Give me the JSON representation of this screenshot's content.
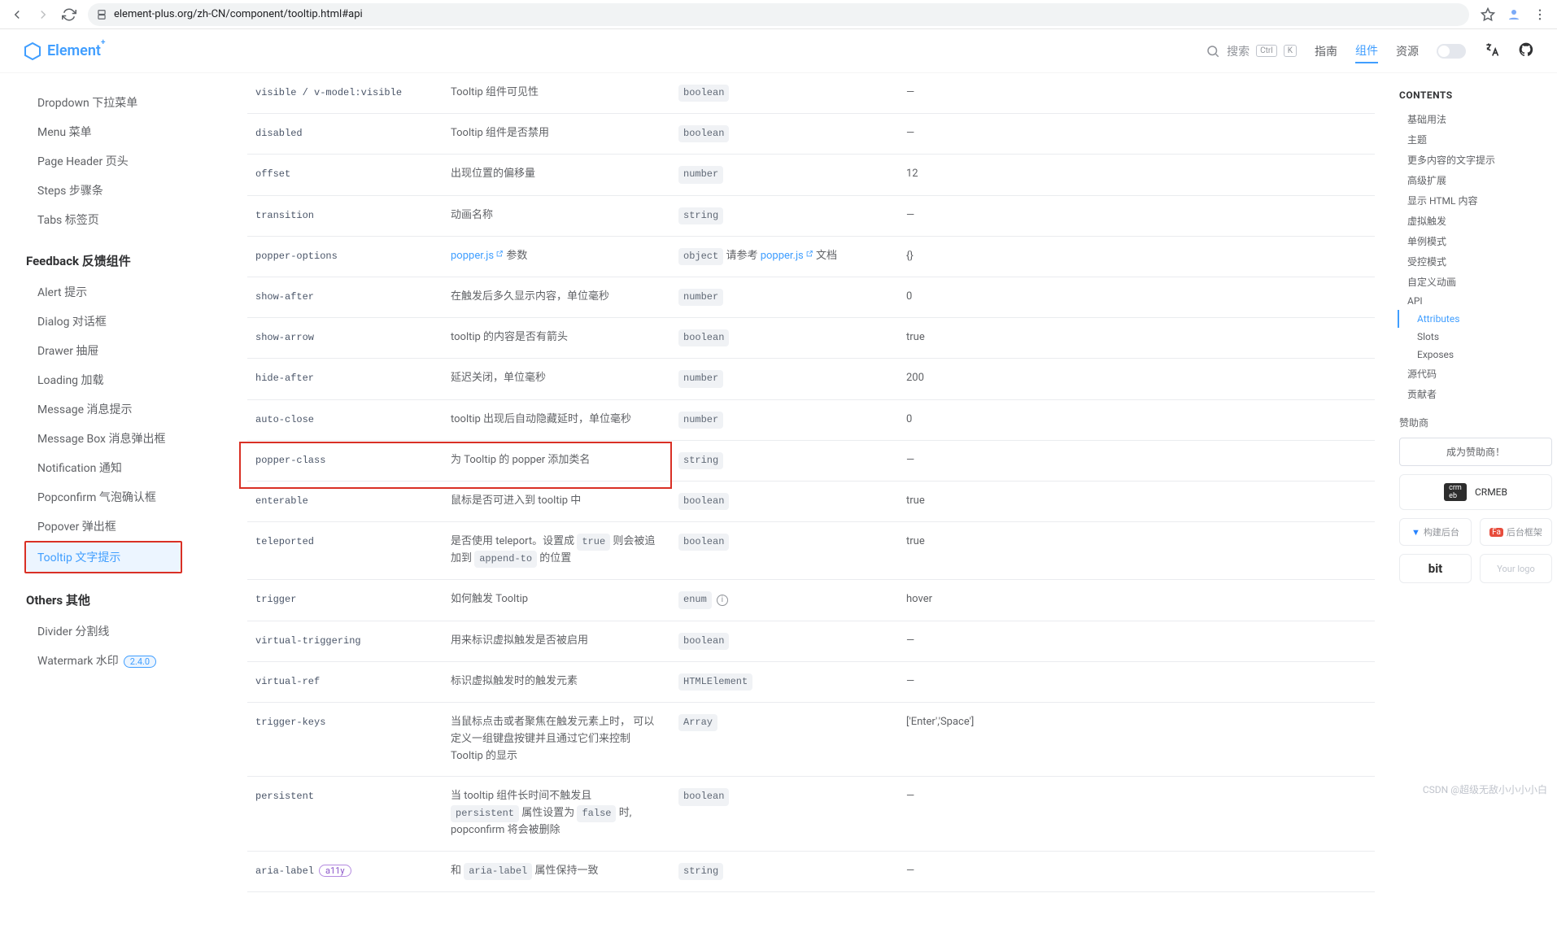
{
  "chrome": {
    "url": "element-plus.org/zh-CN/component/tooltip.html#api"
  },
  "header": {
    "brand": "Element",
    "searchPlaceholder": "搜索",
    "kbd1": "Ctrl",
    "kbd2": "K",
    "nav": {
      "guide": "指南",
      "component": "组件",
      "resource": "资源"
    }
  },
  "sidebar": {
    "items_a": [
      "Dropdown 下拉菜单",
      "Menu 菜单",
      "Page Header 页头",
      "Steps 步骤条",
      "Tabs 标签页"
    ],
    "group_feedback": "Feedback 反馈组件",
    "items_b": [
      "Alert 提示",
      "Dialog 对话框",
      "Drawer 抽屉",
      "Loading 加载",
      "Message 消息提示",
      "Message Box 消息弹出框",
      "Notification 通知",
      "Popconfirm 气泡确认框",
      "Popover 弹出框"
    ],
    "active": "Tooltip 文字提示",
    "group_others": "Others 其他",
    "items_c": [
      "Divider 分割线"
    ],
    "watermark_label": "Watermark 水印",
    "watermark_ver": "2.4.0"
  },
  "api": {
    "rows": [
      {
        "name": "visible / v-model:visible",
        "desc": "Tooltip 组件可见性",
        "type": "boolean",
        "default": "—"
      },
      {
        "name": "disabled",
        "desc": "Tooltip 组件是否禁用",
        "type": "boolean",
        "default": "—"
      },
      {
        "name": "offset",
        "desc": "出现位置的偏移量",
        "type": "number",
        "default": "12"
      },
      {
        "name": "transition",
        "desc": "动画名称",
        "type": "string",
        "default": "—"
      },
      {
        "name": "popper-options",
        "desc_pre": "",
        "link": "popper.js",
        "desc_post": " 参数",
        "type": "object",
        "type_extra_pre": "请参考 ",
        "type_link": "popper.js",
        "type_extra_post": " 文档",
        "default": "{}"
      },
      {
        "name": "show-after",
        "desc": "在触发后多久显示内容，单位毫秒",
        "type": "number",
        "default": "0"
      },
      {
        "name": "show-arrow",
        "desc": "tooltip 的内容是否有箭头",
        "type": "boolean",
        "default": "true"
      },
      {
        "name": "hide-after",
        "desc": "延迟关闭，单位毫秒",
        "type": "number",
        "default": "200"
      },
      {
        "name": "auto-close",
        "desc": "tooltip 出现后自动隐藏延时，单位毫秒",
        "type": "number",
        "default": "0"
      },
      {
        "name": "popper-class",
        "desc": "为 Tooltip 的 popper 添加类名",
        "type": "string",
        "default": "—",
        "highlight": true
      },
      {
        "name": "enterable",
        "desc": "鼠标是否可进入到 tooltip 中",
        "type": "boolean",
        "default": "true"
      },
      {
        "name": "teleported",
        "desc": "是否使用 teleport。设置成 true 则会被追加到 append-to 的位置",
        "type": "boolean",
        "default": "true",
        "desc_code": [
          "true",
          "append-to"
        ]
      },
      {
        "name": "trigger",
        "desc": "如何触发 Tooltip",
        "type": "enum",
        "type_info": true,
        "default": "hover"
      },
      {
        "name": "virtual-triggering",
        "desc": "用来标识虚拟触发是否被启用",
        "type": "boolean",
        "default": "—"
      },
      {
        "name": "virtual-ref",
        "desc": "标识虚拟触发时的触发元素",
        "type": "HTMLElement",
        "default": "—"
      },
      {
        "name": "trigger-keys",
        "desc": "当鼠标点击或者聚焦在触发元素上时， 可以定义一组键盘按键并且通过它们来控制 Tooltip 的显示",
        "type": "Array",
        "default": "['Enter','Space']"
      },
      {
        "name": "persistent",
        "desc": "当 tooltip 组件长时间不触发且 persistent 属性设置为 false 时, popconfirm 将会被删除",
        "type": "boolean",
        "default": "—",
        "desc_code": [
          "persistent",
          "false"
        ]
      },
      {
        "name": "aria-label",
        "badge": "a11y",
        "desc": "和 aria-label 属性保持一致",
        "type": "string",
        "default": "—",
        "desc_code": [
          "aria-label"
        ]
      }
    ]
  },
  "toc": {
    "title": "CONTENTS",
    "items": [
      "基础用法",
      "主题",
      "更多内容的文字提示",
      "高级扩展",
      "显示 HTML 内容",
      "虚拟触发",
      "单例模式",
      "受控模式",
      "自定义动画",
      "API"
    ],
    "sub": {
      "attributes": "Attributes",
      "slots": "Slots",
      "exposes": "Exposes"
    },
    "after": [
      "源代码",
      "贡献者"
    ],
    "sponsor_title": "赞助商",
    "sponsor_btn": "成为赞助商！",
    "crmeb": "CRMEB",
    "vform": "构建后台",
    "fantastic": "后台框架",
    "bit": "bit",
    "yourlogo": "Your logo"
  },
  "watermark": "CSDN @超级无敌小小小小白"
}
